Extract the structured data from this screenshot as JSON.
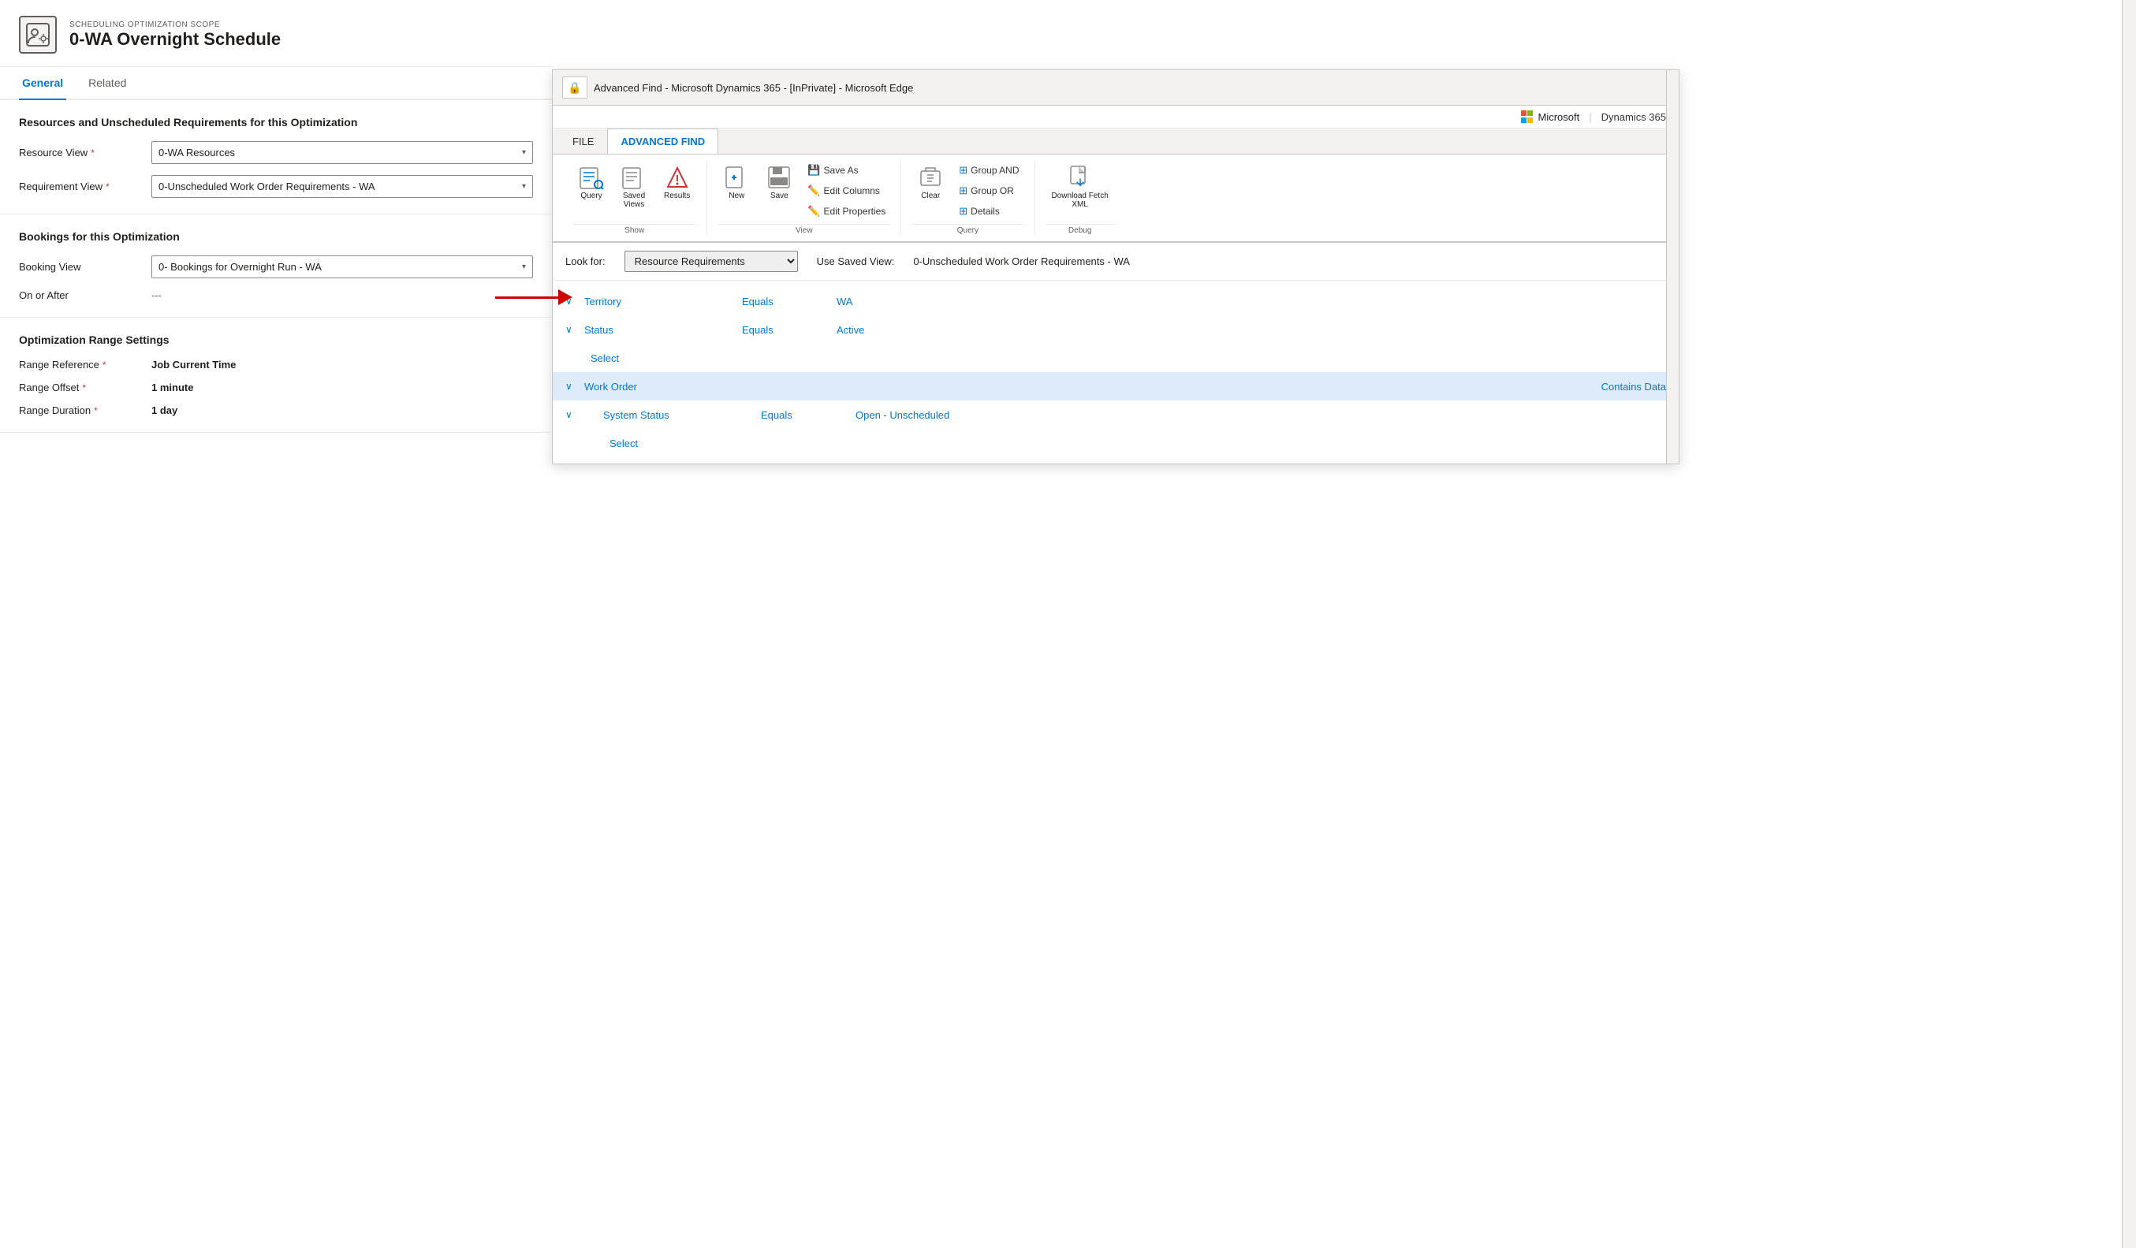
{
  "page": {
    "background": "#f3f2f1"
  },
  "form": {
    "header": {
      "subtitle": "SCHEDULING OPTIMIZATION SCOPE",
      "title": "0-WA Overnight Schedule"
    },
    "tabs": [
      {
        "label": "General",
        "active": true
      },
      {
        "label": "Related",
        "active": false
      }
    ],
    "sections": {
      "resources": {
        "title": "Resources and Unscheduled Requirements for this Optimization",
        "fields": [
          {
            "label": "Resource View",
            "required": true,
            "value": "0-WA Resources"
          },
          {
            "label": "Requirement View",
            "required": true,
            "value": "0-Unscheduled Work Order Requirements - WA"
          }
        ]
      },
      "bookings": {
        "title": "Bookings for this Optimization",
        "fields": [
          {
            "label": "Booking View",
            "required": false,
            "value": "0- Bookings for Overnight Run - WA"
          },
          {
            "label": "On or After",
            "required": false,
            "value": "---"
          }
        ]
      },
      "range": {
        "title": "Optimization Range Settings",
        "fields": [
          {
            "label": "Range Reference",
            "required": true,
            "value": "Job Current Time"
          },
          {
            "label": "Range Offset",
            "required": true,
            "value": "1 minute"
          },
          {
            "label": "Range Duration",
            "required": true,
            "value": "1 day"
          }
        ]
      }
    }
  },
  "dialog": {
    "title": "Advanced Find - Microsoft Dynamics 365 - [InPrivate] - Microsoft Edge",
    "lock_icon": "🔒",
    "brand": {
      "microsoft": "Microsoft",
      "separator": "|",
      "dynamics": "Dynamics 365"
    },
    "ribbon": {
      "tabs": [
        {
          "label": "FILE",
          "active": false
        },
        {
          "label": "ADVANCED FIND",
          "active": true
        }
      ],
      "groups": {
        "show": {
          "label": "Show",
          "buttons": [
            {
              "icon": "📊",
              "label": "Query"
            },
            {
              "icon": "📋",
              "label": "Saved\nViews"
            },
            {
              "icon": "⚠️",
              "label": "Results"
            }
          ]
        },
        "view": {
          "label": "View",
          "buttons": [
            {
              "icon": "📄",
              "label": "New"
            },
            {
              "icon": "💾",
              "label": "Save"
            }
          ],
          "sub_buttons": [
            {
              "icon": "💾",
              "label": "Save As"
            },
            {
              "icon": "✏️",
              "label": "Edit Columns"
            },
            {
              "icon": "✏️",
              "label": "Edit Properties"
            }
          ]
        },
        "query_group": {
          "label": "Query",
          "buttons": [
            {
              "icon": "🧹",
              "label": "Clear"
            }
          ],
          "sub_buttons": [
            {
              "label": "Group AND"
            },
            {
              "label": "Group OR"
            },
            {
              "label": "Details"
            }
          ]
        },
        "debug": {
          "label": "Debug",
          "buttons": [
            {
              "icon": "⬇️",
              "label": "Download Fetch\nXML"
            }
          ]
        }
      }
    },
    "lookup": {
      "look_for_label": "Look for:",
      "look_for_value": "Resource Requirements",
      "use_saved_label": "Use Saved View:",
      "use_saved_value": "0-Unscheduled Work Order Requirements - WA"
    },
    "filters": [
      {
        "indent": 0,
        "chevron": "∨",
        "field": "Territory",
        "operator": "Equals",
        "value": "WA",
        "highlighted": false
      },
      {
        "indent": 0,
        "chevron": "∨",
        "field": "Status",
        "operator": "Equals",
        "value": "Active",
        "highlighted": false
      },
      {
        "indent": 0,
        "chevron": null,
        "field": "Select",
        "operator": "",
        "value": "",
        "highlighted": false,
        "is_select": true
      },
      {
        "indent": 0,
        "chevron": "∨",
        "field": "Work Order",
        "operator": "Contains Data",
        "value": "",
        "highlighted": true
      },
      {
        "indent": 1,
        "chevron": "∨",
        "field": "System Status",
        "operator": "Equals",
        "value": "Open - Unscheduled",
        "highlighted": false
      },
      {
        "indent": 1,
        "chevron": null,
        "field": "Select",
        "operator": "",
        "value": "",
        "highlighted": false,
        "is_select": true
      }
    ]
  }
}
